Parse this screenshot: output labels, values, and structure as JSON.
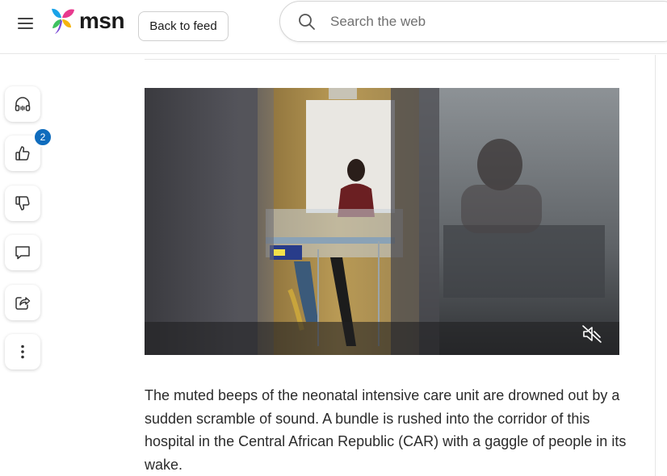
{
  "header": {
    "menu_icon": "hamburger-menu-icon",
    "logo": {
      "icon": "msn-butterfly-icon",
      "text": "msn"
    },
    "back_button_label": "Back to feed",
    "search": {
      "placeholder": "Search the web",
      "value": "",
      "icon": "search-icon"
    }
  },
  "rail": {
    "items": [
      {
        "name": "listen",
        "icon": "headphones-icon"
      },
      {
        "name": "like",
        "icon": "thumbs-up-icon",
        "count": "2"
      },
      {
        "name": "dislike",
        "icon": "thumbs-down-icon"
      },
      {
        "name": "comment",
        "icon": "comment-icon"
      },
      {
        "name": "share",
        "icon": "share-icon"
      },
      {
        "name": "more",
        "icon": "more-vertical-icon"
      }
    ]
  },
  "article": {
    "video": {
      "muted": true,
      "mute_icon": "speaker-muted-icon"
    },
    "paragraph": "The muted beeps of the neonatal intensive care unit are drowned out by a sudden scramble of sound. A bundle is rushed into the corridor of this hospital in the Central African Republic (CAR) with a gaggle of people in its wake."
  },
  "colors": {
    "badge": "#0f6cbd",
    "logo_blue": "#1aa3e8",
    "logo_pink": "#e83a8e",
    "logo_yellow": "#f5b40f",
    "logo_green": "#3ec160"
  }
}
